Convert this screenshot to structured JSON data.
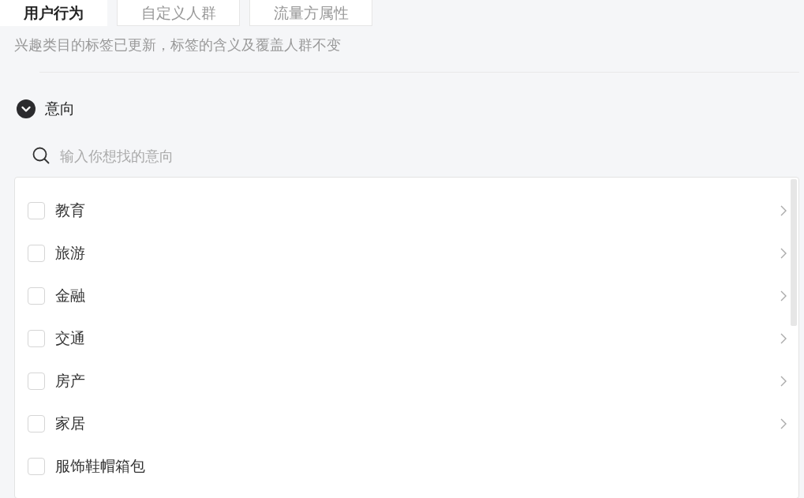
{
  "tabs": [
    {
      "label": "用户行为",
      "selected": true
    },
    {
      "label": "自定义人群",
      "selected": false
    },
    {
      "label": "流量方属性",
      "selected": false
    }
  ],
  "notice": "兴趣类目的标签已更新，标签的含义及覆盖人群不变",
  "section": {
    "title": "意向",
    "expanded": true
  },
  "search": {
    "placeholder": "输入你想找的意向"
  },
  "items": [
    {
      "label": "教育",
      "checked": false,
      "has_children": true
    },
    {
      "label": "旅游",
      "checked": false,
      "has_children": true
    },
    {
      "label": "金融",
      "checked": false,
      "has_children": true
    },
    {
      "label": "交通",
      "checked": false,
      "has_children": true
    },
    {
      "label": "房产",
      "checked": false,
      "has_children": true
    },
    {
      "label": "家居",
      "checked": false,
      "has_children": true
    },
    {
      "label": "服饰鞋帽箱包",
      "checked": false,
      "has_children": false
    }
  ]
}
